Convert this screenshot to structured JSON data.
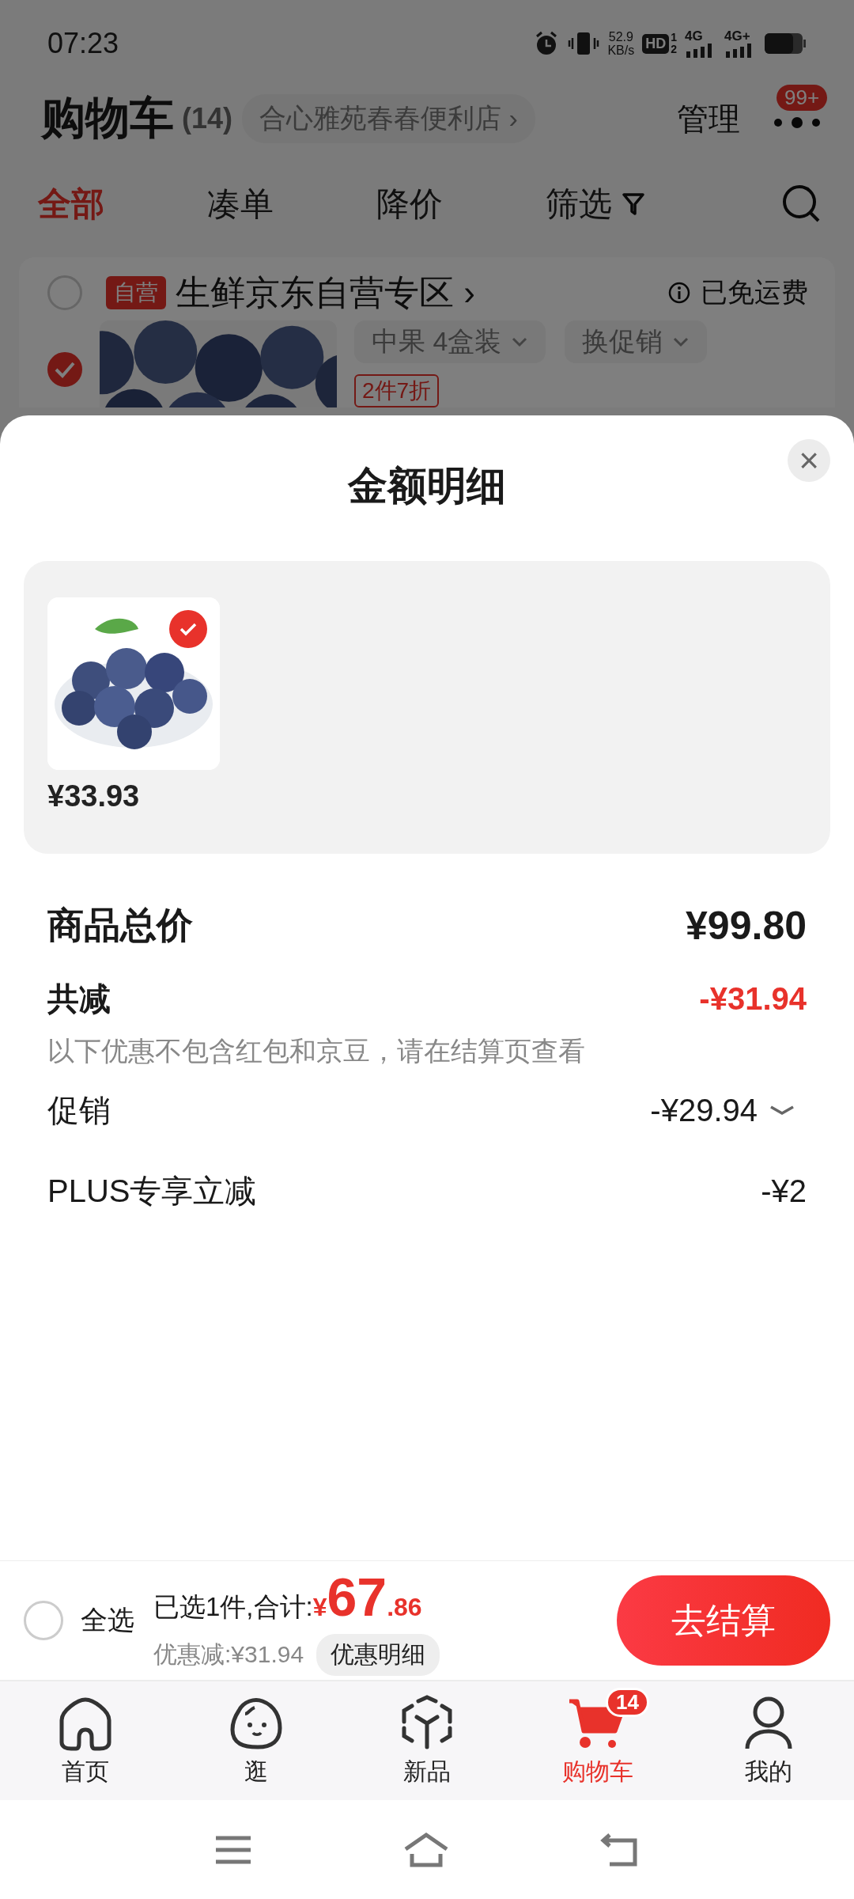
{
  "status_bar": {
    "time": "07:23",
    "speed": "52.9",
    "speed_unit": "KB/s",
    "hd": "HD",
    "sims": [
      "1",
      "2"
    ],
    "networks": [
      "4G",
      "4G+"
    ]
  },
  "header": {
    "title": "购物车",
    "count": "(14)",
    "store": "合心雅苑春春便利店",
    "store_chevron": "›",
    "manage": "管理",
    "more_badge": "99+"
  },
  "tabs": [
    {
      "label": "全部",
      "selected": true,
      "kind": "plain"
    },
    {
      "label": "凑单",
      "selected": false,
      "kind": "plain"
    },
    {
      "label": "降价",
      "selected": false,
      "kind": "plain"
    },
    {
      "label": "筛选",
      "selected": false,
      "kind": "filter"
    }
  ],
  "shop": {
    "checked": false,
    "tag": "自营",
    "name": "生鲜京东自营专区",
    "chevron": "›",
    "shipping": "已免运费"
  },
  "cart_item": {
    "checked": true,
    "spec": "中果 4盒装",
    "promo_select": "换促销",
    "promo_tag": "2件7折"
  },
  "sheet": {
    "title": "金额明细",
    "close": "×",
    "items": [
      {
        "price": "¥33.93",
        "checked": true
      }
    ],
    "rows": [
      {
        "label": "商品总价",
        "value": "¥99.80",
        "kind": "total"
      },
      {
        "label": "共减",
        "value": "-¥31.94",
        "kind": "discount",
        "note": "以下优惠不包含红包和京豆，请在结算页查看"
      },
      {
        "label": "促销",
        "value": "-¥29.94",
        "kind": "expandable",
        "expanded": false
      },
      {
        "label": "PLUS专享立减",
        "value": "-¥2",
        "kind": "item"
      }
    ]
  },
  "checkout": {
    "select_all": {
      "label": "全选",
      "checked": false
    },
    "summary": "已选1件,合计:",
    "currency": "¥",
    "total_int": "67",
    "total_dec": ".86",
    "saving": "优惠减:¥31.94",
    "detail_button": "优惠明细",
    "button": "去结算"
  },
  "nav": [
    {
      "label": "首页",
      "selected": false
    },
    {
      "label": "逛",
      "selected": false
    },
    {
      "label": "新品",
      "selected": false
    },
    {
      "label": "购物车",
      "selected": true,
      "badge": "14"
    },
    {
      "label": "我的",
      "selected": false
    }
  ]
}
